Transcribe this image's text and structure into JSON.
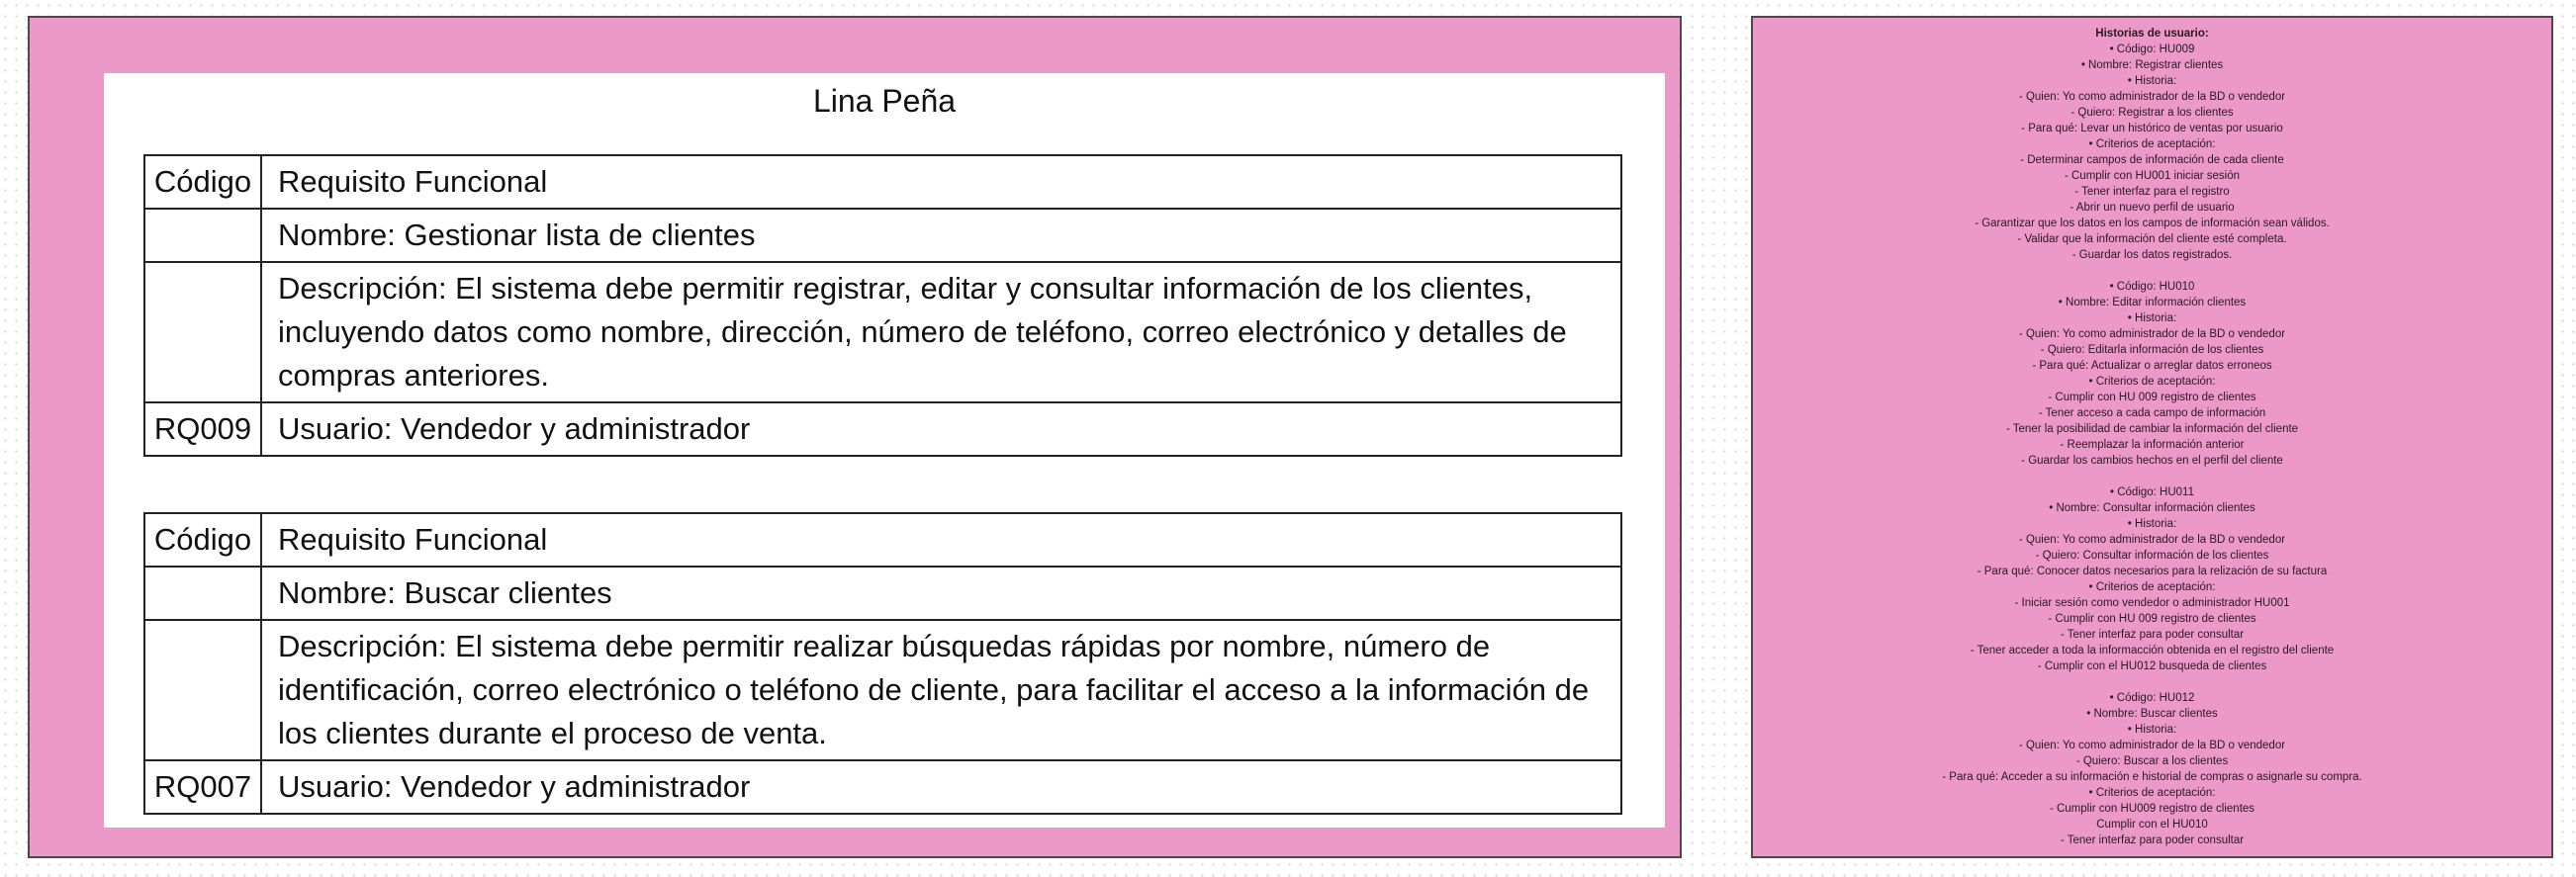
{
  "left": {
    "author": "Lina Peña",
    "tables": [
      {
        "rows": [
          {
            "code": "Código",
            "text": "Requisito Funcional"
          },
          {
            "code": "",
            "text": "Nombre: Gestionar lista de clientes"
          },
          {
            "code": "",
            "text": "Descripción: El sistema debe permitir registrar, editar y consultar información de los clientes, incluyendo datos como nombre, dirección, número de teléfono, correo electrónico y detalles de compras anteriores."
          },
          {
            "code": "RQ009",
            "text": "Usuario: Vendedor y administrador"
          }
        ]
      },
      {
        "rows": [
          {
            "code": "Código",
            "text": "Requisito Funcional"
          },
          {
            "code": "",
            "text": "Nombre: Buscar clientes"
          },
          {
            "code": "",
            "text": "Descripción: El sistema debe permitir realizar búsquedas rápidas por nombre, número de identificación, correo electrónico o teléfono de cliente, para facilitar el acceso a la información de los clientes durante el proceso de venta."
          },
          {
            "code": "RQ007",
            "text": "Usuario: Vendedor y administrador"
          }
        ]
      }
    ]
  },
  "right": {
    "heading": "Historias de usuario:",
    "blocks": [
      [
        "•   Código: HU009",
        "•   Nombre: Registrar clientes",
        "•   Historia:",
        "-   Quien: Yo como administrador de la BD o vendedor",
        "-   Quiero: Registrar a los clientes",
        "-   Para qué: Levar un histórico de ventas por usuario",
        "•   Criterios de aceptación:",
        "-   Determinar campos de información de cada cliente",
        "- Cumplir con HU001 iniciar sesión",
        "- Tener interfaz para el registro",
        "- Abrir un nuevo perfil de usuario",
        "-   Garantizar que los datos en los campos de información sean válidos.",
        "-   Validar que la información del cliente esté completa.",
        "-   Guardar los datos registrados."
      ],
      [
        "•   Código: HU010",
        "•   Nombre: Editar información clientes",
        "•   Historia:",
        "-   Quien: Yo como administrador de la BD o vendedor",
        "-   Quiero: Editarla información de los clientes",
        "-   Para qué: Actualizar o arreglar datos erroneos",
        "•   Criterios de aceptación:",
        "-   Cumplir con HU 009 registro de clientes",
        "-   Tener acceso a cada campo de información",
        "- Tener la posibilidad de cambiar la información del cliente",
        "-   Reemplazar la información anterior",
        "-   Guardar los cambios hechos en el perfil del cliente"
      ],
      [
        "•   Código: HU011",
        "•   Nombre: Consultar información clientes",
        "•   Historia:",
        "-   Quien: Yo como administrador de la BD o vendedor",
        "-   Quiero: Consultar información de los clientes",
        "-   Para qué: Conocer datos necesarios para la relización de su factura",
        "•   Criterios de aceptación:",
        "-   Iniciar sesión como vendedor o  administrador HU001",
        "-   Cumplir con HU 009 registro de clientes",
        "-   Tener interfaz para poder consultar",
        "-   Tener acceder a toda la informacción obtenida en el registro del cliente",
        "-   Cumplir con el HU012 busqueda de clientes"
      ],
      [
        "•   Código: HU012",
        "•   Nombre: Buscar clientes",
        "•   Historia:",
        "-   Quien: Yo como administrador de la BD o vendedor",
        "-   Quiero: Buscar a los clientes",
        "-   Para qué: Acceder a su información e historial de compras o asignarle su compra.",
        "•   Criterios de aceptación:",
        "-   Cumplir con HU009 registro de clientes",
        "Cumplir con el HU010",
        "-   Tener interfaz para poder consultar"
      ]
    ]
  }
}
